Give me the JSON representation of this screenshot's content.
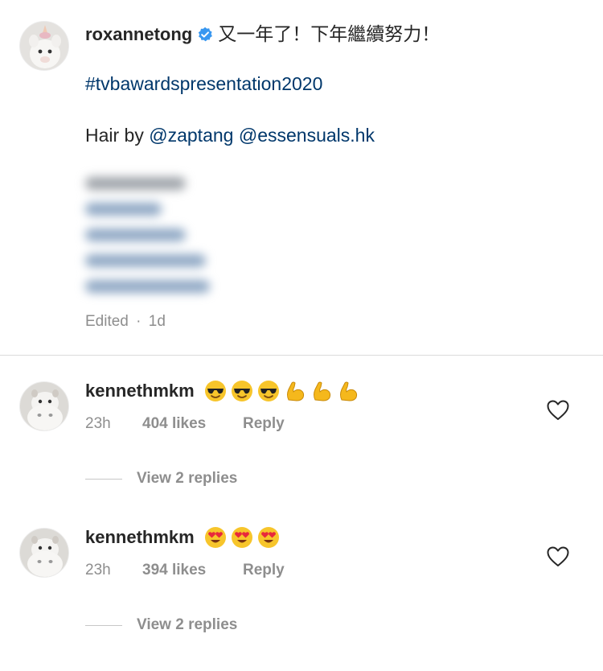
{
  "post": {
    "username": "roxannetong",
    "caption_first": "又一年了！下年繼續努力！",
    "hashtag": "#tvbawardspresentation2020",
    "hair_prefix": "Hair by",
    "hair_mention_1": "@zaptang",
    "hair_mention_2": "@essensuals.hk",
    "edited": "Edited",
    "dot": "·",
    "age": "1d"
  },
  "comments": [
    {
      "username": "kennethmkm",
      "emojis": [
        "sunglasses-emoji",
        "sunglasses-emoji",
        "sunglasses-emoji",
        "flexed-biceps-emoji",
        "flexed-biceps-emoji",
        "flexed-biceps-emoji"
      ],
      "time": "23h",
      "likes": "404 likes",
      "reply_label": "Reply",
      "view_replies": "View 2 replies"
    },
    {
      "username": "kennethmkm",
      "emojis": [
        "heart-eyes-emoji",
        "heart-eyes-emoji",
        "heart-eyes-emoji"
      ],
      "time": "23h",
      "likes": "394 likes",
      "reply_label": "Reply",
      "view_replies": "View 2 replies"
    }
  ],
  "colors": {
    "text": "#262626",
    "secondary": "#8e8e8e",
    "link": "#00376b",
    "verified": "#3897f0",
    "divider": "#dbdbdb"
  }
}
